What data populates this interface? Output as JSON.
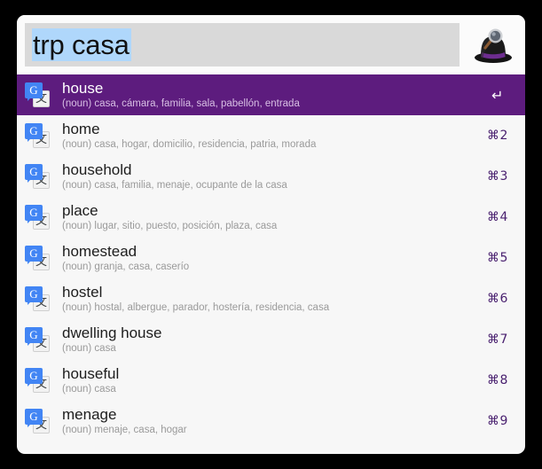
{
  "app": {
    "name": "Alfred",
    "icon": "alfred-hat-magnifier-icon"
  },
  "search": {
    "value": "trp casa",
    "placeholder": "",
    "selected_text": "trp casa"
  },
  "results": [
    {
      "icon": "google-translate-icon",
      "icon_front_glyph": "G",
      "icon_back_glyph": "文",
      "title": "house",
      "subtitle": "(noun) casa, cámara, familia, sala, pabellón, entrada",
      "hint": "↵",
      "selected": true
    },
    {
      "icon": "google-translate-icon",
      "icon_front_glyph": "G",
      "icon_back_glyph": "文",
      "title": "home",
      "subtitle": "(noun) casa, hogar, domicilio, residencia, patria, morada",
      "hint": "⌘2",
      "selected": false
    },
    {
      "icon": "google-translate-icon",
      "icon_front_glyph": "G",
      "icon_back_glyph": "文",
      "title": "household",
      "subtitle": "(noun) casa, familia, menaje, ocupante de la casa",
      "hint": "⌘3",
      "selected": false
    },
    {
      "icon": "google-translate-icon",
      "icon_front_glyph": "G",
      "icon_back_glyph": "文",
      "title": "place",
      "subtitle": "(noun) lugar, sitio, puesto, posición, plaza, casa",
      "hint": "⌘4",
      "selected": false
    },
    {
      "icon": "google-translate-icon",
      "icon_front_glyph": "G",
      "icon_back_glyph": "文",
      "title": "homestead",
      "subtitle": "(noun) granja, casa, caserío",
      "hint": "⌘5",
      "selected": false
    },
    {
      "icon": "google-translate-icon",
      "icon_front_glyph": "G",
      "icon_back_glyph": "文",
      "title": "hostel",
      "subtitle": "(noun) hostal, albergue, parador, hostería, residencia, casa",
      "hint": "⌘6",
      "selected": false
    },
    {
      "icon": "google-translate-icon",
      "icon_front_glyph": "G",
      "icon_back_glyph": "文",
      "title": "dwelling house",
      "subtitle": "(noun) casa",
      "hint": "⌘7",
      "selected": false
    },
    {
      "icon": "google-translate-icon",
      "icon_front_glyph": "G",
      "icon_back_glyph": "文",
      "title": "houseful",
      "subtitle": "(noun) casa",
      "hint": "⌘8",
      "selected": false
    },
    {
      "icon": "google-translate-icon",
      "icon_front_glyph": "G",
      "icon_back_glyph": "文",
      "title": "menage",
      "subtitle": "(noun) menaje, casa, hogar",
      "hint": "⌘9",
      "selected": false
    }
  ],
  "colors": {
    "selection_purple": "#5d1c7e",
    "hint_purple": "#49206f",
    "search_field_bg": "#d9d9d9",
    "search_selection_blue": "#afd7fb",
    "window_bg": "#f7f7f7",
    "google_blue": "#4285f4"
  }
}
